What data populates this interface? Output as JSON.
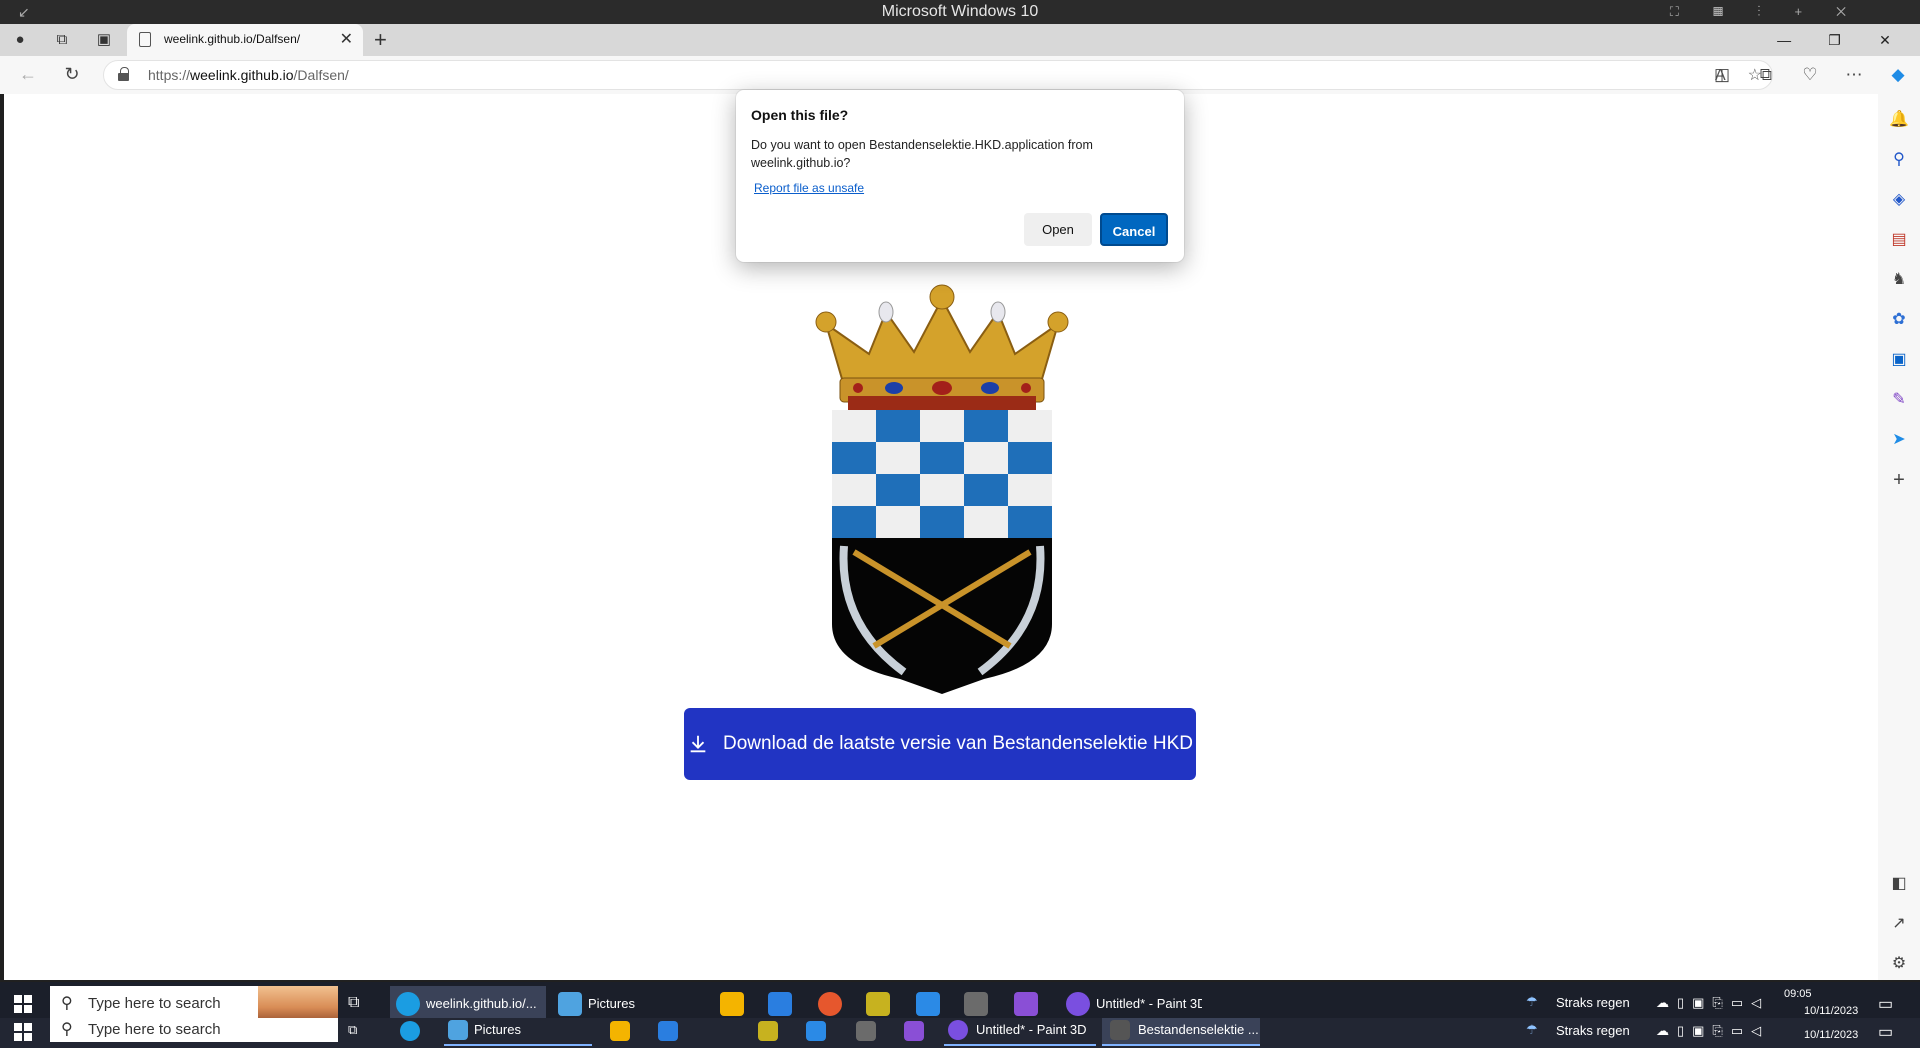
{
  "rdp_bar": {
    "title": "Microsoft Windows 10"
  },
  "browser": {
    "tab_title": "weelink.github.io/Dalfsen/",
    "url_prefix": "https://",
    "url_host": "weelink.github.io",
    "url_path": "/Dalfsen/"
  },
  "dialog": {
    "title": "Open this file?",
    "message": "Do you want to open Bestandenselektie.HKD.application from weelink.github.io?",
    "report_link": "Report file as unsafe",
    "open_label": "Open",
    "cancel_label": "Cancel"
  },
  "page": {
    "download_label": "Download de laatste versie van Bestandenselektie HKD"
  },
  "taskbar": {
    "search_placeholder": "Type here to search",
    "apps": [
      {
        "label": "weelink.github.io/..."
      },
      {
        "label": "Pictures"
      },
      {
        "label": "Untitled* - Paint 3D"
      }
    ],
    "weather": "Straks regen",
    "time": "09:05",
    "date": "10/11/2023"
  },
  "taskbar2": {
    "search_placeholder": "Type here to search",
    "apps": [
      {
        "label": "Pictures"
      },
      {
        "label": "Untitled* - Paint 3D"
      },
      {
        "label": "Bestandenselektie ..."
      }
    ],
    "weather": "Straks regen",
    "date": "10/11/2023"
  },
  "colors": {
    "download_button": "#2134c3",
    "dialog_cancel": "#0067c0",
    "crest_blue": "#1f6fb9",
    "crest_black": "#050505",
    "crown_gold": "#d4a22b"
  }
}
